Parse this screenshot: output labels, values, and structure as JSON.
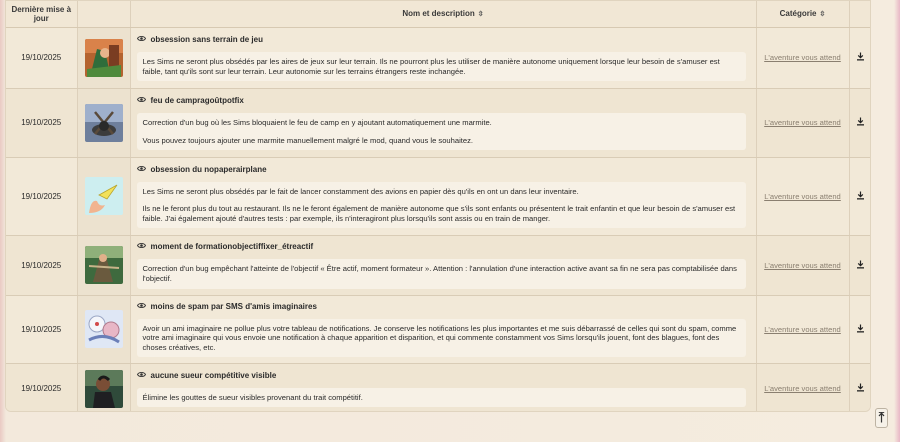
{
  "table": {
    "headers": {
      "date": "Dernière mise à jour",
      "name": "Nom et description",
      "category": "Catégorie",
      "sort_icon": "sort-icon"
    },
    "rows": [
      {
        "date": "19/10/2025",
        "title": "obsession sans terrain de jeu",
        "description": [
          "Les Sims ne seront plus obsédés par les aires de jeux sur leur terrain. Ils ne pourront plus les utiliser de manière autonome uniquement lorsque leur besoin de s'amuser est faible, tant qu'ils sont sur leur terrain. Leur autonomie sur les terrains étrangers reste inchangée."
        ],
        "category": "L'aventure vous attend"
      },
      {
        "date": "19/10/2025",
        "title": "feu de campragoûtpotfix",
        "description": [
          "Correction d'un bug où les Sims bloquaient le feu de camp en y ajoutant automatiquement une marmite.",
          "Vous pouvez toujours ajouter une marmite manuellement malgré le mod, quand vous le souhaitez."
        ],
        "category": "L'aventure vous attend"
      },
      {
        "date": "19/10/2025",
        "title": "obsession du nopaperairplane",
        "description": [
          "Les Sims ne seront plus obsédés par le fait de lancer constamment des avions en papier dès qu'ils en ont un dans leur inventaire.",
          "Ils ne le feront plus du tout au restaurant. Ils ne le feront également de manière autonome que s'ils sont enfants ou présentent le trait enfantin et que leur besoin de s'amuser est faible. J'ai également ajouté d'autres tests : par exemple, ils n'interagiront plus lorsqu'ils sont assis ou en train de manger."
        ],
        "category": "L'aventure vous attend"
      },
      {
        "date": "19/10/2025",
        "title": "moment de formationobjectiffixer_étreactif",
        "description": [
          "Correction d'un bug empêchant l'atteinte de l'objectif « Être actif, moment formateur ». Attention : l'annulation d'une interaction active avant sa fin ne sera pas comptabilisée dans l'objectif."
        ],
        "category": "L'aventure vous attend"
      },
      {
        "date": "19/10/2025",
        "title": "moins de spam par SMS d'amis imaginaires",
        "description": [
          "Avoir un ami imaginaire ne pollue plus votre tableau de notifications. Je conserve les notifications les plus importantes et me suis débarrassé de celles qui sont du spam, comme votre ami imaginaire qui vous envoie une notification à chaque apparition et disparition, et qui commente constamment vos Sims lorsqu'ils jouent, font des blagues, font des choses créatives, etc."
        ],
        "category": "L'aventure vous attend"
      },
      {
        "date": "19/10/2025",
        "title": "aucune sueur compétitive visible",
        "description": [
          "Élimine les gouttes de sueur visibles provenant du trait compétitif."
        ],
        "category": "L'aventure vous attend"
      }
    ]
  },
  "icons": {
    "view": "eye-icon",
    "download": "download-icon",
    "scroll_top": "arrow-up-icon"
  }
}
